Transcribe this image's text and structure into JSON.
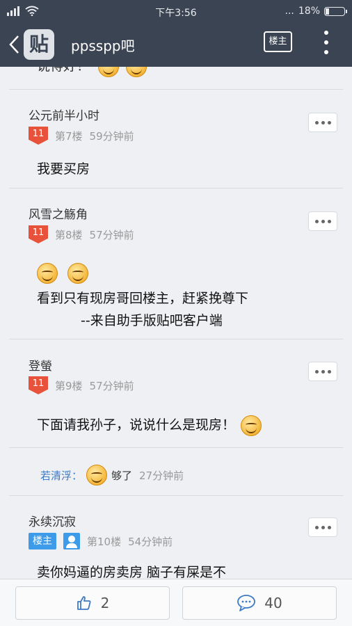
{
  "status_bar": {
    "time": "下午3:56",
    "battery": "18%",
    "battery_level": 0.18,
    "dots": "..."
  },
  "header": {
    "logo_text": "贴",
    "title": "ppsspp吧",
    "louzhu_button": "楼主",
    "icons": [
      "back-arrow-icon",
      "more-vert-icon"
    ]
  },
  "top_fragment": {
    "text": "说得好！"
  },
  "posts": [
    {
      "user": "公元前半小时",
      "level": "11",
      "floor": "第7楼",
      "time": "59分钟前",
      "text": "我要买房"
    },
    {
      "user": "风雪之觞角",
      "level": "11",
      "floor": "第8楼",
      "time": "57分钟前",
      "line1": "看到只有现房哥回楼主，赶紧挽尊下",
      "line2": "--来自助手版贴吧客户端"
    },
    {
      "user": "登螢",
      "level": "11",
      "floor": "第9楼",
      "time": "57分钟前",
      "text": "下面请我孙子，说说什么是现房！",
      "reply": {
        "name": "若清浮：",
        "text": "够了",
        "time": "27分钟前"
      }
    },
    {
      "user": "永续沉寂",
      "badge": "楼主",
      "floor": "第10楼",
      "time": "54分钟前",
      "text": "卖你妈逼的房卖房 脑子有屎是不"
    }
  ],
  "bottom_bar": {
    "like_count": "2",
    "comment_count": "40",
    "icons": [
      "thumbs-up-icon",
      "comment-icon"
    ]
  },
  "colors": {
    "header_bg": "#3b4452",
    "level_badge": "#e8513a",
    "owner_badge": "#3d9be9",
    "reply_name": "#3d7ac4"
  }
}
